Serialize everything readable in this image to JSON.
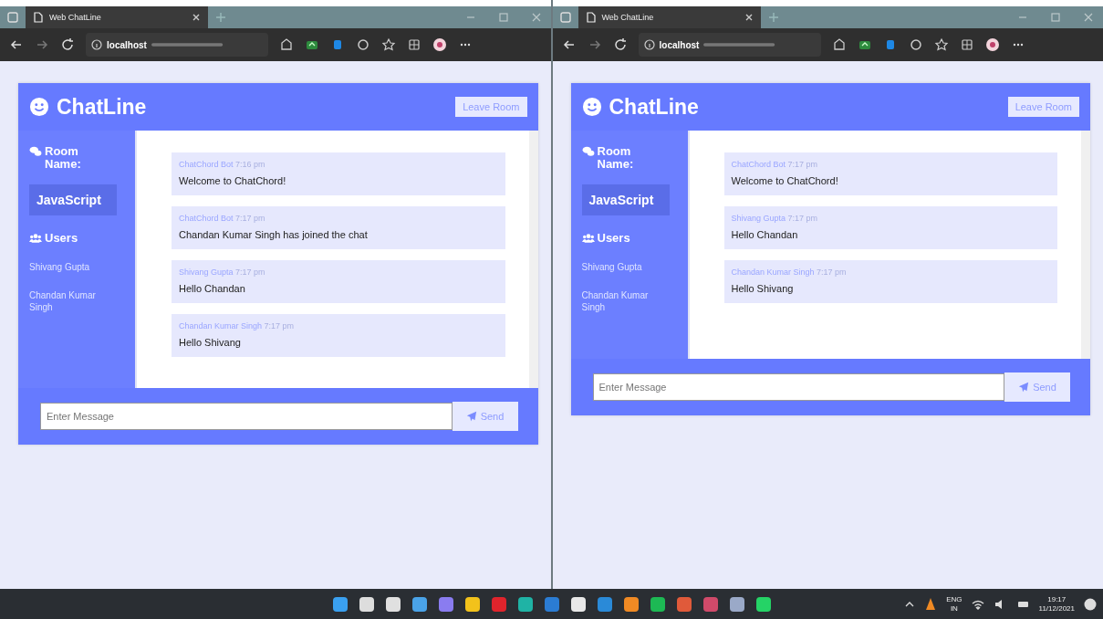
{
  "windows": [
    {
      "tab_title": "Web ChatLine",
      "url_host": "localhost",
      "app": {
        "title": "ChatLine",
        "leave_button": "Leave Room",
        "room_label": "Room Name:",
        "room_name": "JavaScript",
        "users_label": "Users",
        "users": [
          "Shivang Gupta",
          "Chandan Kumar Singh"
        ],
        "messages": [
          {
            "author": "ChatChord Bot",
            "time": "7:16 pm",
            "text": "Welcome to ChatChord!"
          },
          {
            "author": "ChatChord Bot",
            "time": "7:17 pm",
            "text": "Chandan Kumar Singh has joined the chat"
          },
          {
            "author": "Shivang Gupta",
            "time": "7:17 pm",
            "text": "Hello Chandan"
          },
          {
            "author": "Chandan Kumar Singh",
            "time": "7:17 pm",
            "text": "Hello Shivang"
          }
        ],
        "input_placeholder": "Enter Message",
        "send_button": "Send"
      }
    },
    {
      "tab_title": "Web ChatLine",
      "url_host": "localhost",
      "app": {
        "title": "ChatLine",
        "leave_button": "Leave Room",
        "room_label": "Room Name:",
        "room_name": "JavaScript",
        "users_label": "Users",
        "users": [
          "Shivang Gupta",
          "Chandan Kumar Singh"
        ],
        "messages": [
          {
            "author": "ChatChord Bot",
            "time": "7:17 pm",
            "text": "Welcome to ChatChord!"
          },
          {
            "author": "Shivang Gupta",
            "time": "7:17 pm",
            "text": "Hello Chandan"
          },
          {
            "author": "Chandan Kumar Singh",
            "time": "7:17 pm",
            "text": "Hello Shivang"
          }
        ],
        "input_placeholder": "Enter Message",
        "send_button": "Send"
      }
    }
  ],
  "taskbar": {
    "language": "ENG",
    "region": "IN",
    "time": "19:17",
    "date": "11/12/2021"
  }
}
